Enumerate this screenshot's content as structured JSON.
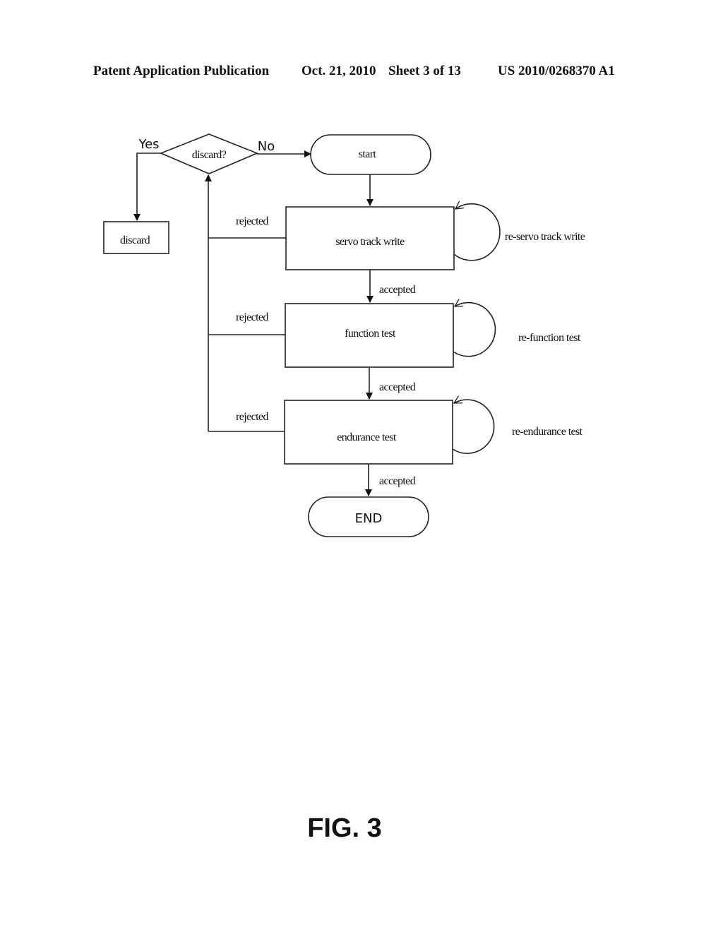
{
  "header": {
    "left": "Patent Application Publication",
    "date": "Oct. 21, 2010",
    "sheet": "Sheet 3 of 13",
    "number": "US 2010/0268370 A1"
  },
  "diagram": {
    "decision": "discard?",
    "yes_label": "Yes",
    "no_label": "No",
    "start": "start",
    "discard_box": "discard",
    "steps": [
      {
        "label": "servo track write",
        "retry": "re-servo track write"
      },
      {
        "label": "function test",
        "retry": "re-function test"
      },
      {
        "label": "endurance test",
        "retry": "re-endurance test"
      }
    ],
    "rejected_label": "rejected",
    "accepted_label": "accepted",
    "end": "END"
  },
  "figure_label": "FIG. 3"
}
